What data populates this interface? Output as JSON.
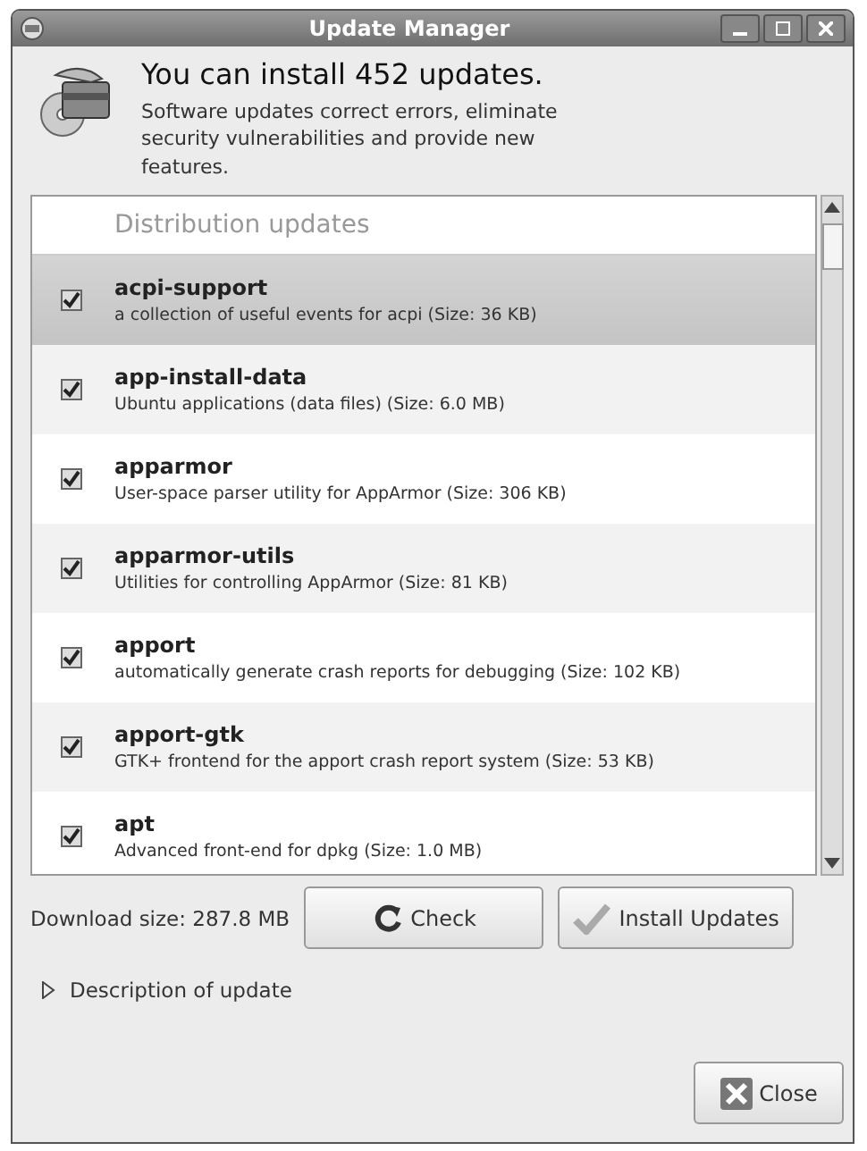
{
  "window": {
    "title": "Update Manager"
  },
  "header": {
    "title": "You can install 452 updates.",
    "description": "Software updates correct errors, eliminate security vulnerabilities and provide new features."
  },
  "update_list": {
    "group": "Distribution updates",
    "rows": [
      {
        "name": "acpi-support",
        "description": "a collection of useful events for acpi (Size: 36 KB)",
        "checked": true,
        "selected": true
      },
      {
        "name": "app-install-data",
        "description": "Ubuntu applications (data files) (Size: 6.0 MB)",
        "checked": true,
        "selected": false
      },
      {
        "name": "apparmor",
        "description": "User-space parser utility for AppArmor (Size: 306 KB)",
        "checked": true,
        "selected": false
      },
      {
        "name": "apparmor-utils",
        "description": "Utilities for controlling AppArmor (Size: 81 KB)",
        "checked": true,
        "selected": false
      },
      {
        "name": "apport",
        "description": "automatically generate crash reports for debugging (Size: 102 KB)",
        "checked": true,
        "selected": false
      },
      {
        "name": "apport-gtk",
        "description": "GTK+ frontend for the apport crash report system (Size: 53 KB)",
        "checked": true,
        "selected": false
      },
      {
        "name": "apt",
        "description": "Advanced front-end for dpkg (Size: 1.0 MB)",
        "checked": true,
        "selected": false
      }
    ]
  },
  "download_size": "Download size: 287.8 MB",
  "buttons": [
    {
      "label": "Check",
      "kind": "check"
    },
    {
      "label": "Install Updates",
      "kind": "install"
    }
  ],
  "expander": {
    "label": "Description of update",
    "expanded": false
  },
  "close_button": {
    "label": "Close"
  }
}
